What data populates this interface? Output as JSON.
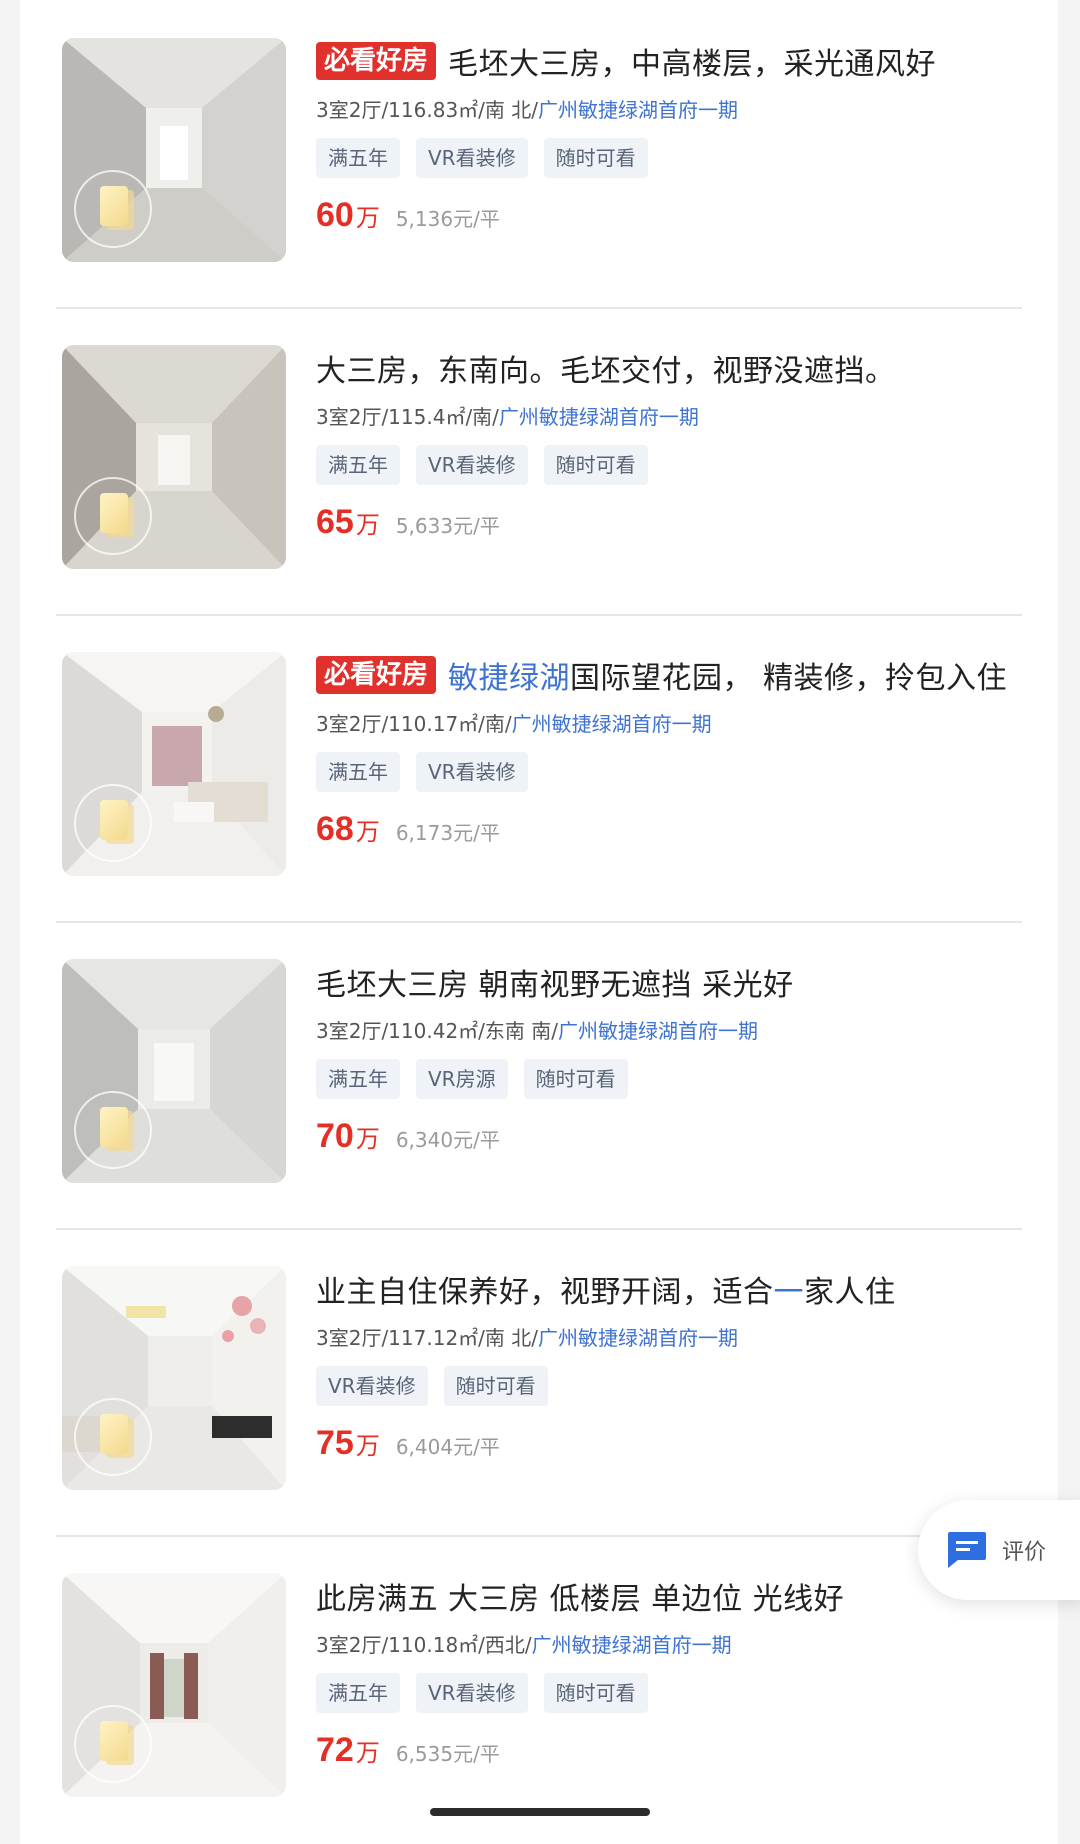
{
  "listings": [
    {
      "hot_tag": "必看好房",
      "title": "毛坯大三房，中高楼层，采光通风好",
      "meta": "3室2厅/116.83㎡/南 北/",
      "community": "广州敏捷绿湖首府一期",
      "tags": [
        "满五年",
        "VR看装修",
        "随时可看"
      ],
      "price": "60",
      "unit": "万",
      "ppsm": "5,136元/平"
    },
    {
      "hot_tag": "",
      "title": "大三房，东南向。毛坯交付，视野没遮挡。",
      "meta": "3室2厅/115.4㎡/南/",
      "community": "广州敏捷绿湖首府一期",
      "tags": [
        "满五年",
        "VR看装修",
        "随时可看"
      ],
      "price": "65",
      "unit": "万",
      "ppsm": "5,633元/平"
    },
    {
      "hot_tag": "必看好房",
      "title_blue": "敏捷绿湖",
      "title": "国际望花园， 精装修，拎包入住",
      "meta": "3室2厅/110.17㎡/南/",
      "community": "广州敏捷绿湖首府一期",
      "tags": [
        "满五年",
        "VR看装修"
      ],
      "price": "68",
      "unit": "万",
      "ppsm": "6,173元/平"
    },
    {
      "hot_tag": "",
      "title": "毛坯大三房 朝南视野无遮挡 采光好",
      "meta": "3室2厅/110.42㎡/东南 南/",
      "community": "广州敏捷绿湖首府一期",
      "tags": [
        "满五年",
        "VR房源",
        "随时可看"
      ],
      "price": "70",
      "unit": "万",
      "ppsm": "6,340元/平"
    },
    {
      "hot_tag": "",
      "title": "业主自住保养好，视野开阔，适合",
      "title_blue": "一",
      "title_after": "家人住",
      "meta": "3室2厅/117.12㎡/南 北/",
      "community": "广州敏捷绿湖首府一期",
      "tags": [
        "VR看装修",
        "随时可看"
      ],
      "price": "75",
      "unit": "万",
      "ppsm": "6,404元/平"
    },
    {
      "hot_tag": "",
      "title": "此房满五 大三房 低楼层 单边位 光线好",
      "meta": "3室2厅/110.18㎡/西北/",
      "community": "广州敏捷绿湖首府一期",
      "tags": [
        "满五年",
        "VR看装修",
        "随时可看"
      ],
      "price": "72",
      "unit": "万",
      "ppsm": "6,535元/平"
    }
  ],
  "feedback": {
    "label": "评价",
    "icon": "chat-icon"
  }
}
